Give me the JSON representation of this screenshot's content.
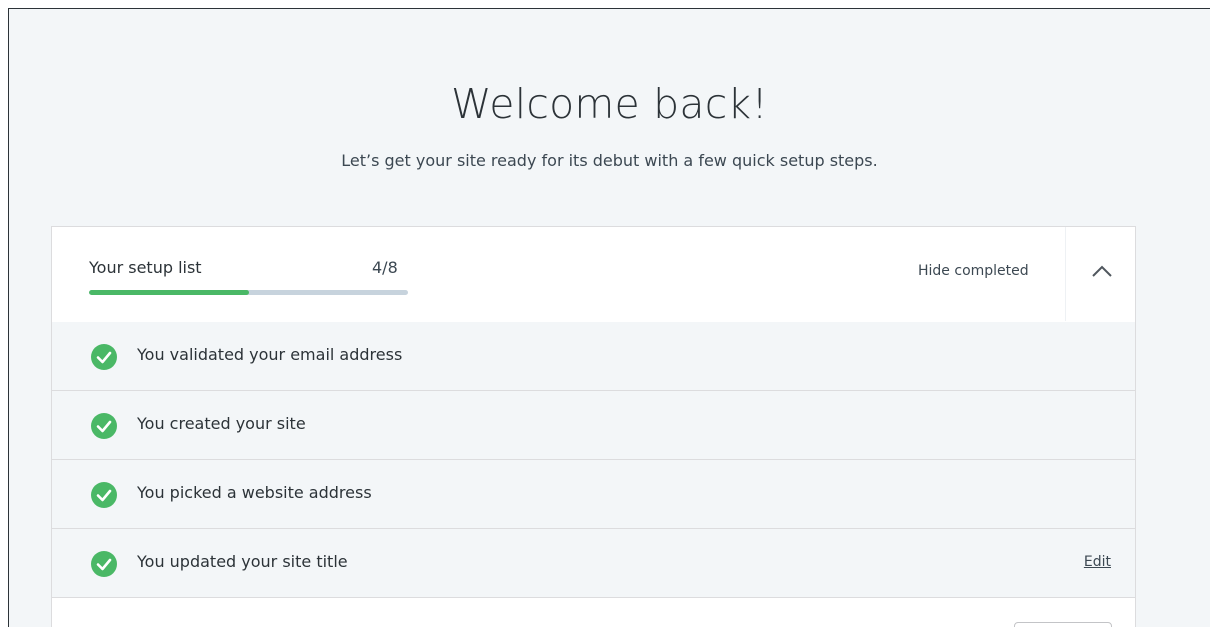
{
  "header": {
    "title": "Welcome back!",
    "subtitle": "Let’s get your site ready for its debut with a few quick setup steps."
  },
  "setup": {
    "label": "Your setup list",
    "count": "4/8",
    "progress_fraction": 0.5,
    "hide_completed_label": "Hide completed",
    "toggle_icon": "chevron-up-icon"
  },
  "tasks": [
    {
      "label": "You validated your email address",
      "status": "completed",
      "icon": "check-circle-icon"
    },
    {
      "label": "You created your site",
      "status": "completed",
      "icon": "check-circle-icon"
    },
    {
      "label": "You picked a website address",
      "status": "completed",
      "icon": "check-circle-icon"
    },
    {
      "label": "You updated your site title",
      "status": "completed",
      "icon": "check-circle-icon",
      "action": "Edit"
    }
  ],
  "colors": {
    "accent_green": "#4ab866",
    "track": "#c7d3dd",
    "background": "#f3f6f8"
  }
}
